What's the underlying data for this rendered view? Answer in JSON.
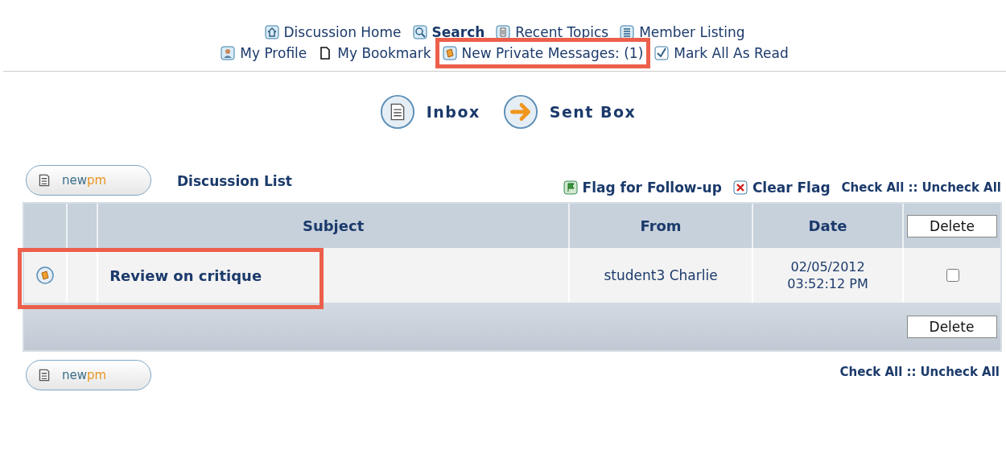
{
  "nav_rows": [
    [
      {
        "label": "Discussion Home",
        "bold": false,
        "highlighted": false
      },
      {
        "label": "Search",
        "bold": true,
        "highlighted": false
      },
      {
        "label": "Recent Topics",
        "bold": false,
        "highlighted": false
      },
      {
        "label": "Member Listing",
        "bold": false,
        "highlighted": false
      }
    ],
    [
      {
        "label": "My Profile",
        "bold": false,
        "highlighted": false
      },
      {
        "label": "My Bookmark",
        "bold": false,
        "highlighted": false
      },
      {
        "label": "New Private Messages: (1)",
        "bold": false,
        "highlighted": true
      },
      {
        "label": "Mark All As Read",
        "bold": false,
        "highlighted": false
      }
    ]
  ],
  "boxes": [
    {
      "label": "Inbox"
    },
    {
      "label": "Sent Box"
    }
  ],
  "new_pm_button": {
    "label_a": "new",
    "label_b": "pm"
  },
  "list_title": "Discussion List",
  "actions": [
    {
      "label": "Flag for Follow-up"
    },
    {
      "label": "Clear Flag"
    }
  ],
  "check_all": "Check All",
  "separator": "::",
  "uncheck_all": "Uncheck All",
  "table": {
    "columns": [
      "Subject",
      "From",
      "Date"
    ],
    "delete_label": "Delete",
    "rows": [
      {
        "subject": "Review on critique",
        "from": "student3 Charlie",
        "date": "02/05/2012",
        "time": "03:52:12 PM",
        "checked": false,
        "highlighted": true
      }
    ],
    "footer_delete_label": "Delete"
  },
  "bottom": {
    "new_pm_button": {
      "label_a": "new",
      "label_b": "pm"
    },
    "check_all": "Check All",
    "separator": "::",
    "uncheck_all": "Uncheck All"
  }
}
